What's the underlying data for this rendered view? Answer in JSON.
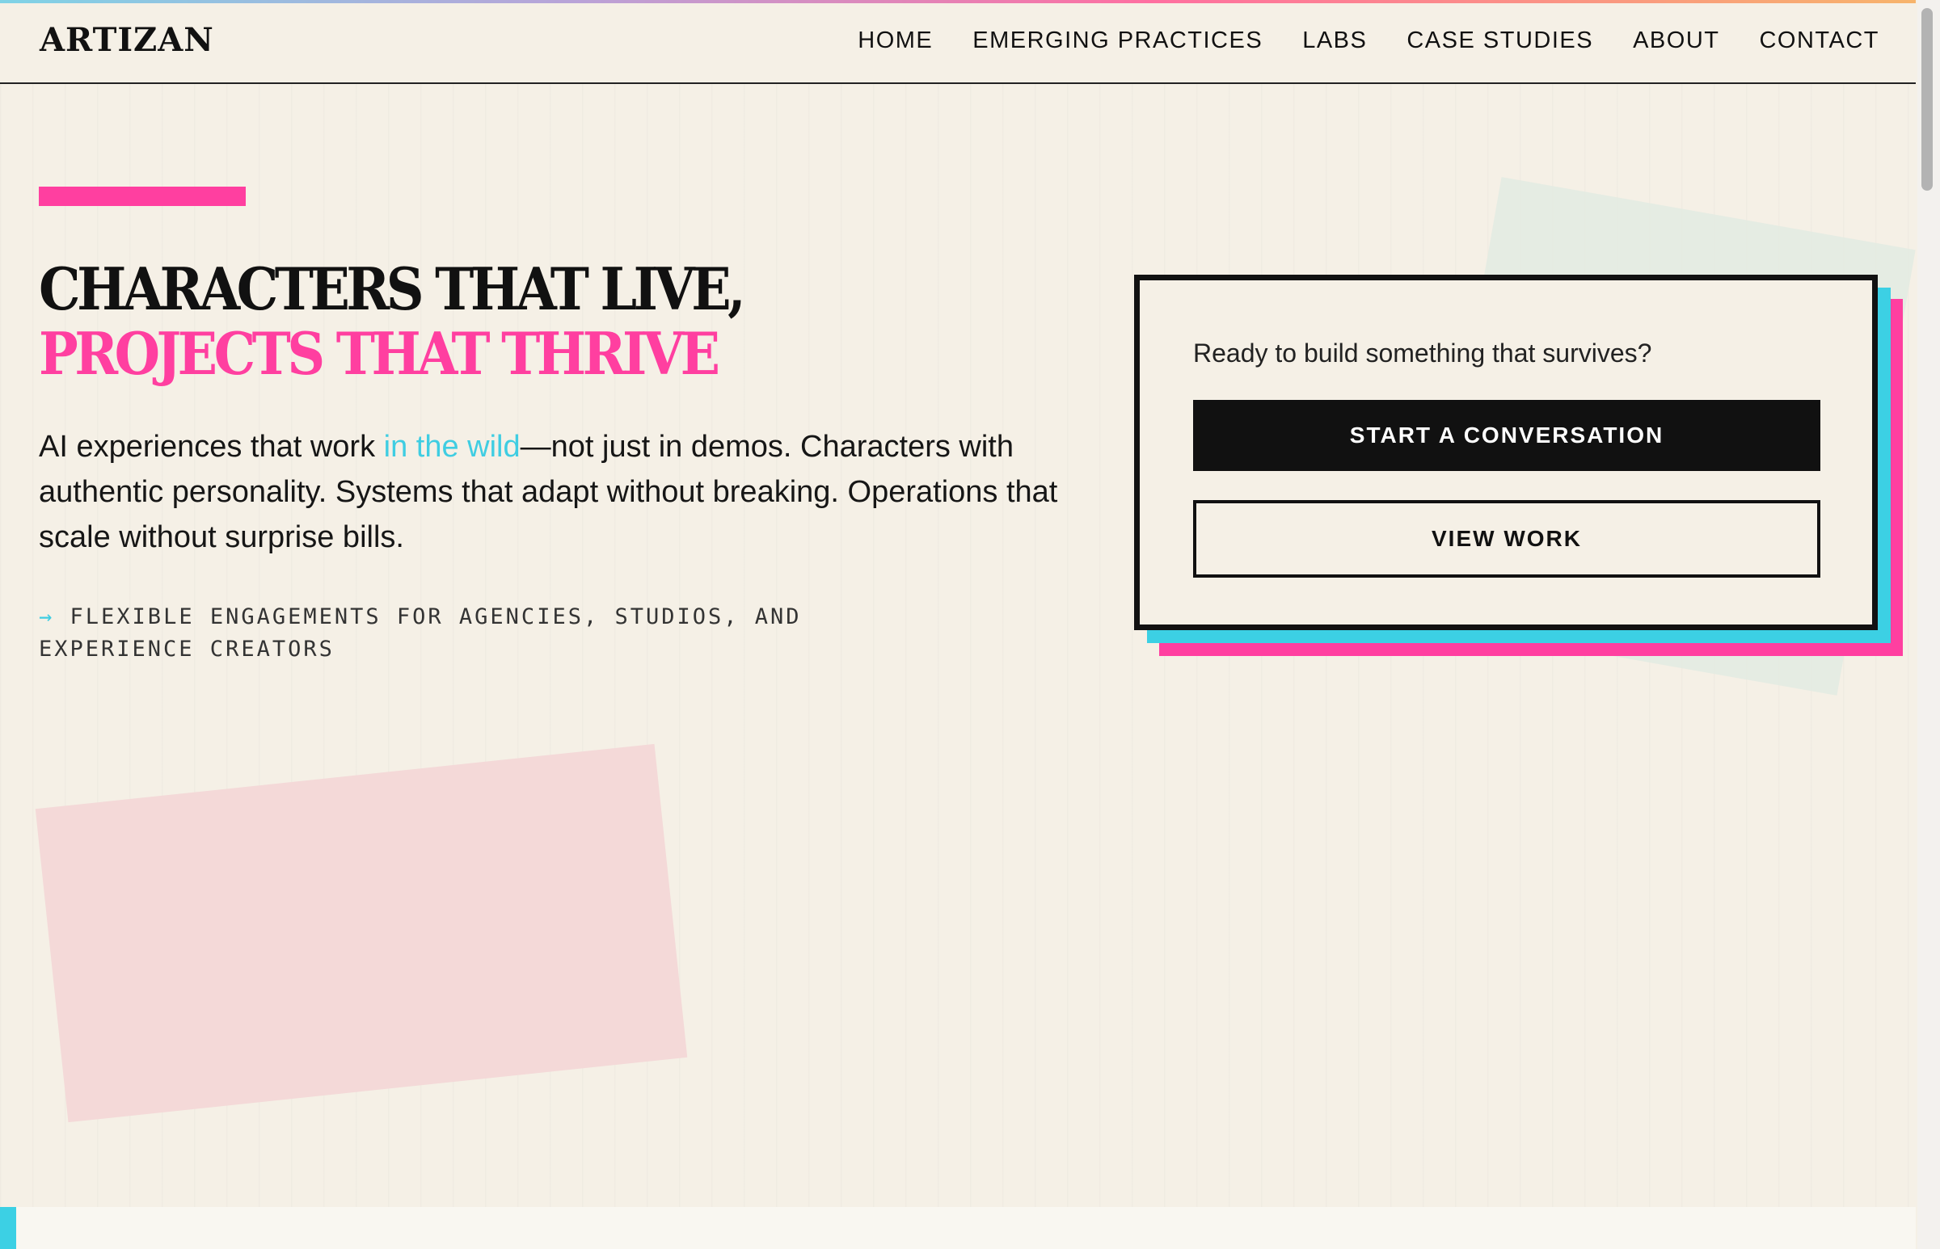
{
  "brand": {
    "logo": "ARTIZAN"
  },
  "nav": {
    "items": [
      "HOME",
      "EMERGING PRACTICES",
      "LABS",
      "CASE STUDIES",
      "ABOUT",
      "CONTACT"
    ]
  },
  "hero": {
    "headline_line1": "CHARACTERS THAT LIVE,",
    "headline_line2": "PROJECTS THAT THRIVE",
    "lead_before": "AI experiences that work ",
    "lead_accent": "in the wild",
    "lead_after": "—not just in demos. Characters with authentic personality. Systems that adapt without breaking. Operations that scale without surprise bills.",
    "tagline_arrow": "→",
    "tagline": "FLEXIBLE ENGAGEMENTS FOR AGENCIES, STUDIOS, AND EXPERIENCE CREATORS"
  },
  "cta_card": {
    "question": "Ready to build something that survives?",
    "primary_label": "START A CONVERSATION",
    "secondary_label": "VIEW WORK"
  },
  "colors": {
    "background": "#f5f0e6",
    "pink": "#ff3fa0",
    "cyan": "#3cd0e4",
    "ink": "#111111"
  }
}
